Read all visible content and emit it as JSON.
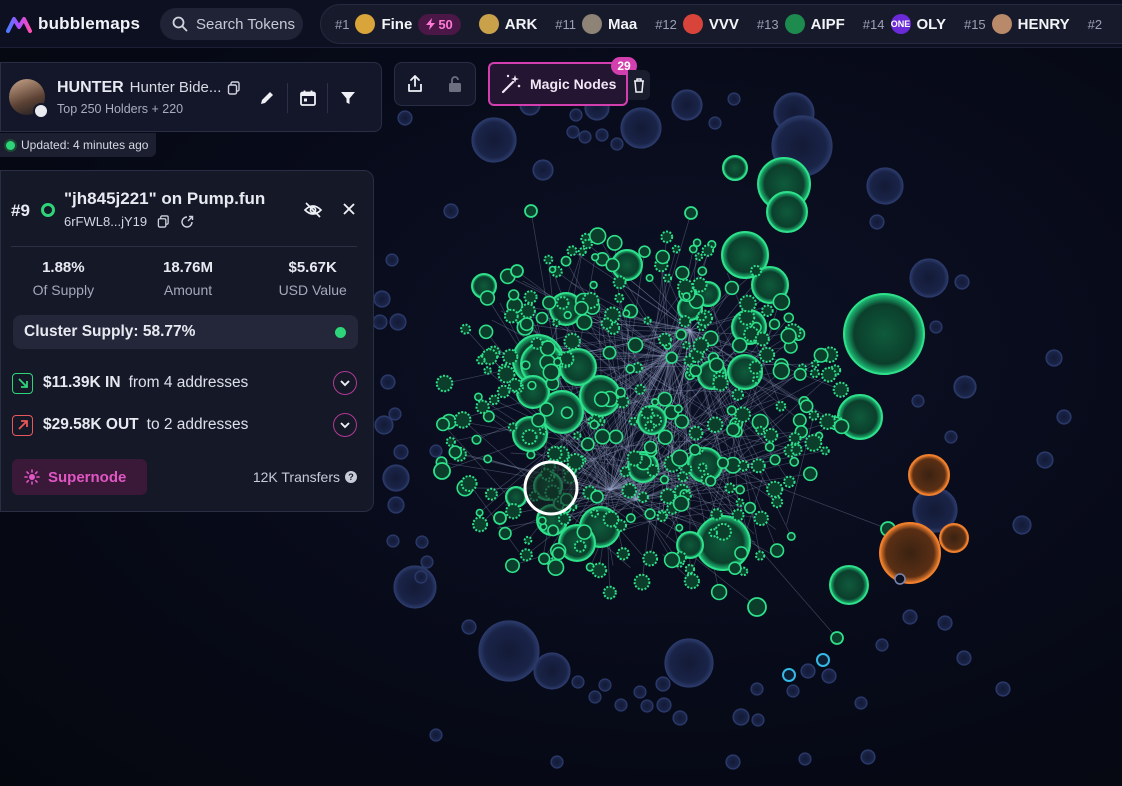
{
  "app": {
    "name": "bubblemaps"
  },
  "search": {
    "placeholder": "Search Tokens"
  },
  "ticker": [
    {
      "rank": "#1",
      "name": "Fine",
      "boost": "50",
      "icon": "dog-face-icon",
      "icon_color": "#d9a43a"
    },
    {
      "rank": "",
      "name": "ARK",
      "icon": "ark-logo-icon",
      "icon_color": "#c9a14a"
    },
    {
      "rank": "#11",
      "name": "Maa",
      "icon": "avatar-icon",
      "icon_color": "#8d8477"
    },
    {
      "rank": "#12",
      "name": "VVV",
      "icon": "red-glyph-icon",
      "icon_color": "#d9443a"
    },
    {
      "rank": "#13",
      "name": "AIPF",
      "icon": "green-leaf-icon",
      "icon_color": "#1d8a4e"
    },
    {
      "rank": "#14",
      "name": "OLY",
      "icon": "one-badge-icon",
      "icon_color": "#6a2ad8",
      "icon_text": "ONE"
    },
    {
      "rank": "#15",
      "name": "HENRY",
      "icon": "portrait-icon",
      "icon_color": "#b98a6a"
    },
    {
      "rank": "#2",
      "name": "",
      "icon": "",
      "icon_color": ""
    }
  ],
  "token": {
    "ticker": "HUNTER",
    "name": "Hunter Bide...",
    "subtitle": "Top 250 Holders + 220",
    "updated": "Updated: 4 minutes ago"
  },
  "magic_nodes": {
    "label": "Magic Nodes",
    "count": "29"
  },
  "node": {
    "rank": "#9",
    "title": "\"jh845j221\" on Pump.fun",
    "address": "6rFWL8...jY19",
    "stats": [
      {
        "value": "1.88%",
        "label": "Of Supply"
      },
      {
        "value": "18.76M",
        "label": "Amount"
      },
      {
        "value": "$5.67K",
        "label": "USD Value"
      }
    ],
    "cluster_supply": "Cluster Supply: 58.77%",
    "in": {
      "amount": "$11.39K IN",
      "text": "from 4 addresses"
    },
    "out": {
      "amount": "$29.58K OUT",
      "text": "to 2 addresses"
    },
    "supernode_label": "Supernode",
    "transfers": "12K Transfers"
  },
  "colors": {
    "accent_pink": "#d43fb0",
    "green": "#2ed47a",
    "orange": "#e8782a",
    "navy_bubble": "#1a2448",
    "cyan": "#35b9e6"
  }
}
